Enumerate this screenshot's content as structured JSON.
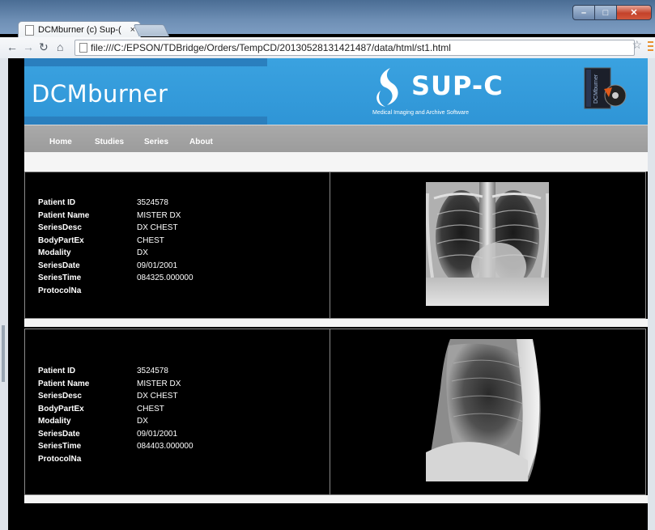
{
  "browser": {
    "tab_title": "DCMburner (c) Sup-(",
    "tab_close": "×",
    "url": "file:///C:/EPSON/TDBridge/Orders/TempCD/20130528131421487/data/html/st1.html"
  },
  "header": {
    "title": "DCMburner",
    "logo_text": "SUP-C",
    "tagline": "Medical Imaging and Archive Software",
    "product_label": "DCMburner"
  },
  "nav": {
    "items": [
      "Home",
      "Studies",
      "Series",
      "About"
    ]
  },
  "series": [
    {
      "fields": [
        {
          "label": "Patient ID",
          "value": "3524578"
        },
        {
          "label": "Patient Name",
          "value": "MISTER DX"
        },
        {
          "label": "SeriesDesc",
          "value": "DX CHEST"
        },
        {
          "label": "BodyPartEx",
          "value": "CHEST"
        },
        {
          "label": "Modality",
          "value": "DX"
        },
        {
          "label": "SeriesDate",
          "value": "09/01/2001"
        },
        {
          "label": "SeriesTime",
          "value": "084325.000000"
        },
        {
          "label": "ProtocolNa",
          "value": ""
        }
      ],
      "image": "chest-pa-xray"
    },
    {
      "fields": [
        {
          "label": "Patient ID",
          "value": "3524578"
        },
        {
          "label": "Patient Name",
          "value": "MISTER DX"
        },
        {
          "label": "SeriesDesc",
          "value": "DX CHEST"
        },
        {
          "label": "BodyPartEx",
          "value": "CHEST"
        },
        {
          "label": "Modality",
          "value": "DX"
        },
        {
          "label": "SeriesDate",
          "value": "09/01/2001"
        },
        {
          "label": "SeriesTime",
          "value": "084403.000000"
        },
        {
          "label": "ProtocolNa",
          "value": ""
        }
      ],
      "image": "chest-lateral-xray"
    }
  ],
  "colors": {
    "header_blue": "#3aa2e0",
    "nav_gray": "#a4a4a4",
    "background": "#000000"
  }
}
